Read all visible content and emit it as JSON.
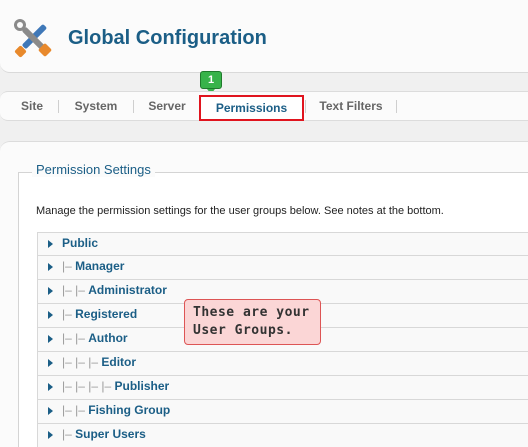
{
  "header": {
    "title": "Global Configuration",
    "icon": "tools-icon"
  },
  "step_badge": "1",
  "tabs": [
    {
      "label": "Site",
      "active": false
    },
    {
      "label": "System",
      "active": false
    },
    {
      "label": "Server",
      "active": false
    },
    {
      "label": "Permissions",
      "active": true
    },
    {
      "label": "Text Filters",
      "active": false
    }
  ],
  "permission_settings": {
    "legend": "Permission Settings",
    "description": "Manage the permission settings for the user groups below. See notes at the bottom.",
    "groups": [
      {
        "indent": "",
        "label": "Public"
      },
      {
        "indent": "|– ",
        "label": "Manager"
      },
      {
        "indent": "|– |– ",
        "label": "Administrator"
      },
      {
        "indent": "|– ",
        "label": "Registered"
      },
      {
        "indent": "|– |– ",
        "label": "Author"
      },
      {
        "indent": "|– |– |– ",
        "label": "Editor"
      },
      {
        "indent": "|– |– |– |– ",
        "label": "Publisher"
      },
      {
        "indent": "|– |– ",
        "label": "Fishing Group"
      },
      {
        "indent": "|– ",
        "label": "Super Users"
      }
    ]
  },
  "callout": {
    "line1": "These are your",
    "line2": "User Groups."
  },
  "colors": {
    "title": "#1b5e86",
    "active_tab_border": "#e0141e",
    "badge": "#37b34a",
    "callout_bg": "#fbd6d6"
  }
}
